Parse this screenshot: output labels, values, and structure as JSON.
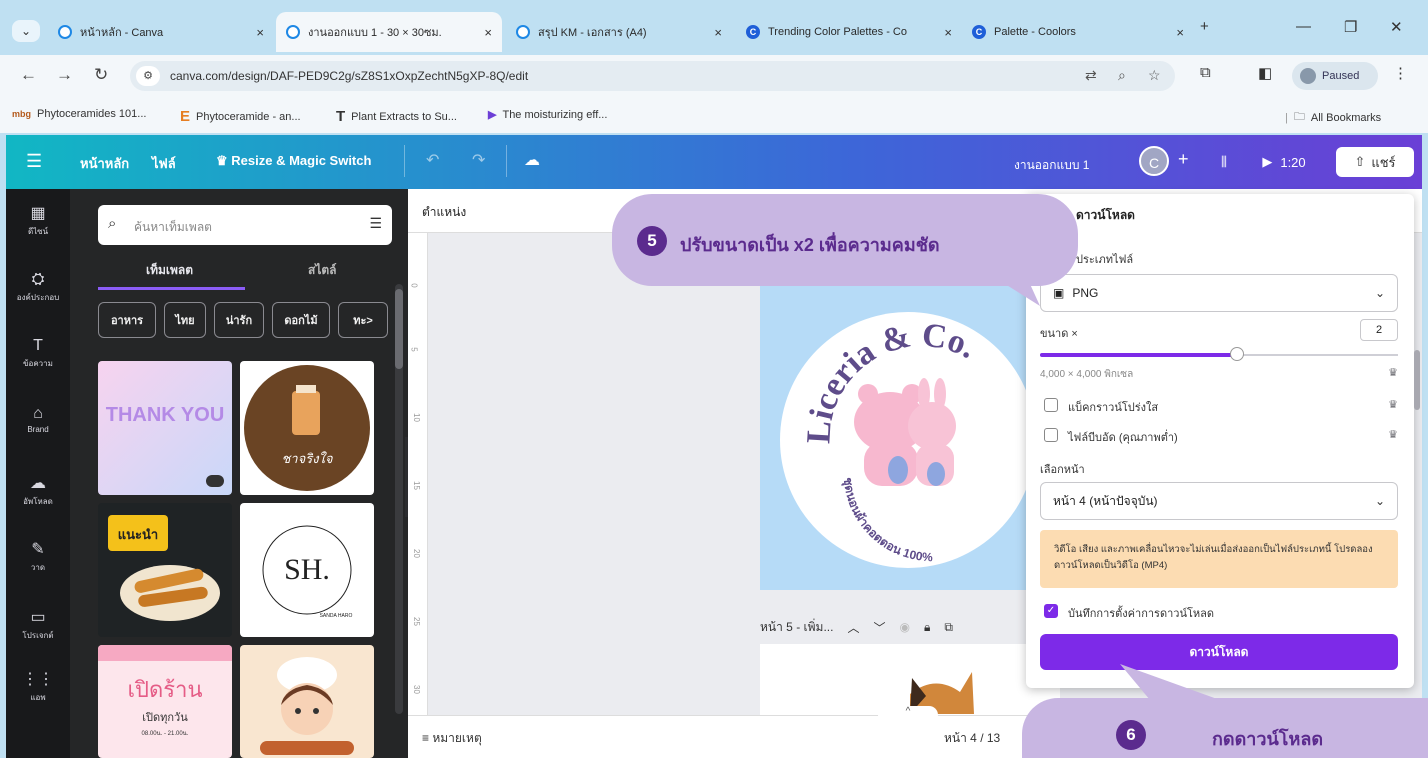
{
  "browser": {
    "tabs": [
      {
        "title": "หน้าหลัก - Canva",
        "icon": "canva-favicon"
      },
      {
        "title": "งานออกแบบ 1 - 30 × 30ซม.",
        "icon": "canva-favicon"
      },
      {
        "title": "สรุป KM - เอกสาร (A4)",
        "icon": "canva-favicon"
      },
      {
        "title": "Trending Color Palettes - Co",
        "icon": "coolors-favicon"
      },
      {
        "title": "Palette - Coolors",
        "icon": "coolors-favicon"
      }
    ],
    "close_glyph": "×",
    "new_tab_glyph": "+",
    "url": "canva.com/design/DAF-PED9C2g/sZ8S1xOxpZechtN5gXP-8Q/edit",
    "profile_status": "Paused",
    "bookmarks": [
      {
        "label": "Phytoceramides 101...",
        "icon_text": "mbg"
      },
      {
        "label": "Phytoceramide - an...",
        "icon_text": "E"
      },
      {
        "label": "Plant Extracts to Su...",
        "icon_text": "T"
      },
      {
        "label": "The moisturizing eff...",
        "icon_text": "▶"
      }
    ],
    "all_bookmarks": "All Bookmarks"
  },
  "canva": {
    "header": {
      "home": "หน้าหลัก",
      "file": "ไฟล์",
      "resize": "Resize & Magic Switch",
      "design_title": "งานออกแบบ 1",
      "avatar_letter": "C",
      "duration": "1:20",
      "share": "แชร์"
    },
    "rail": [
      {
        "label": "ดีไซน์",
        "icon": "▦"
      },
      {
        "label": "องค์ประกอบ",
        "icon": "⛭"
      },
      {
        "label": "ข้อความ",
        "icon": "T"
      },
      {
        "label": "Brand",
        "icon": "⌂"
      },
      {
        "label": "อัพโหลด",
        "icon": "☁"
      },
      {
        "label": "วาด",
        "icon": "✎"
      },
      {
        "label": "โปรเจกต์",
        "icon": "▭"
      },
      {
        "label": "แอพ",
        "icon": "⋮⋮"
      }
    ],
    "panel": {
      "search_placeholder": "ค้นหาเท็มเพลต",
      "tabs": [
        "เท็มเพลต",
        "สไตล์"
      ],
      "chips": [
        "อาหาร",
        "ไทย",
        "น่ารัก",
        "ดอกไม้"
      ],
      "chip_more": "ทะ>",
      "thumbnails": {
        "thank_you": "THANK YOU",
        "cafe": "ชาจริงใจ",
        "food": "แนะนำ",
        "logo": "SH.",
        "logo_sub": "SANDA HARO",
        "shop": "เปิดร้าน",
        "shop_sub": "เปิดทุกวัน",
        "shop_hours": "08.00น. - 21.00น."
      }
    },
    "canvas": {
      "position_label": "ตำแหน่ง",
      "ruler_ticks": [
        "0",
        "5",
        "10",
        "15",
        "20",
        "25",
        "30"
      ],
      "design_text": "Liceria & Co.",
      "design_subtext": "ชุดนอนผ้าคอตตอน 100%",
      "next_page": "หน้า 5 - เพิ่ม...",
      "notes": "หมายเหตุ",
      "page_count": "หน้า 4 / 13"
    },
    "download": {
      "title": "ดาวน์โหลด",
      "filetype_label": "ประเภทไฟล์",
      "filetype": "PNG",
      "size_label": "ขนาด ×",
      "size_value": "2",
      "size_fraction": 0.55,
      "dimensions": "4,000 × 4,000 พิกเซล",
      "transparent_bg": "แบ็คกราวน์โปร่งใส",
      "compress": "ไฟล์บีบอัด (คุณภาพต่ำ)",
      "select_pages_label": "เลือกหน้า",
      "select_pages": "หน้า 4 (หน้าปัจจุบัน)",
      "notice": "วิดีโอ เสียง และภาพเคลื่อนไหวจะไม่เล่นเมื่อส่งออกเป็นไฟล์ประเภทนี้ โปรดลองดาวน์โหลดเป็นวิดีโอ (MP4)",
      "save_settings": "บันทึกการตั้งค่าการดาวน์โหลด",
      "button": "ดาวน์โหลด"
    }
  },
  "callouts": {
    "step5_number": "5",
    "step5_text": "ปรับขนาดเป็น x2 เพื่อความคมชัด",
    "step6_number": "6",
    "step6_text": "กดดาวน์โหลด"
  },
  "colors": {
    "canva_purple": "#7d2ae8",
    "callout_bg": "#c8b6e2",
    "callout_text": "#5b2b8e"
  }
}
